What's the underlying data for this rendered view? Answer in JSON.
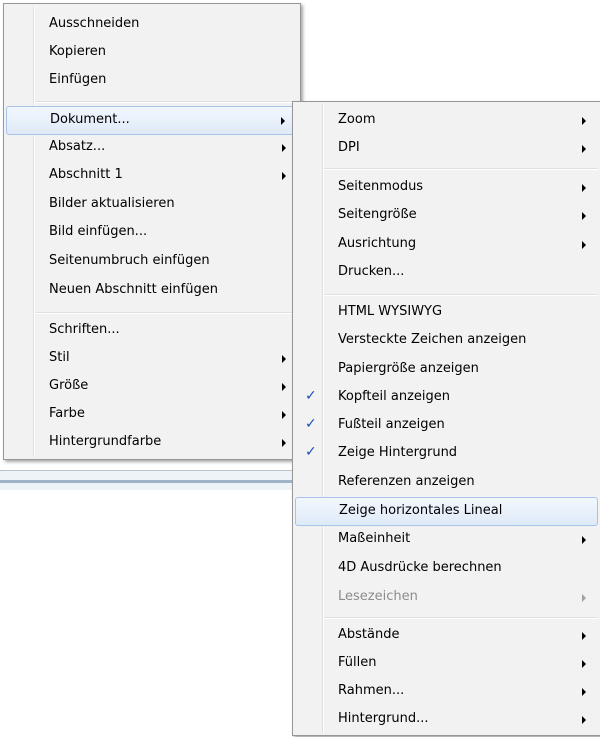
{
  "menu1": {
    "items": {
      "ausschneiden": {
        "label": "Ausschneiden"
      },
      "kopieren": {
        "label": "Kopieren"
      },
      "einfuegen": {
        "label": "Einfügen"
      },
      "dokument": {
        "label": "Dokument..."
      },
      "absatz": {
        "label": "Absatz..."
      },
      "abschnitt": {
        "label": "Abschnitt 1"
      },
      "bilder_aktualisieren": {
        "label": "Bilder aktualisieren"
      },
      "bild_einfuegen": {
        "label": "Bild einfügen..."
      },
      "seitenumbruch": {
        "label": "Seitenumbruch einfügen"
      },
      "neuer_abschnitt": {
        "label": "Neuen Abschnitt einfügen"
      },
      "schriften": {
        "label": "Schriften..."
      },
      "stil": {
        "label": "Stil"
      },
      "groesse": {
        "label": "Größe"
      },
      "farbe": {
        "label": "Farbe"
      },
      "hintergrundfarbe": {
        "label": "Hintergrundfarbe"
      }
    }
  },
  "menu2": {
    "items": {
      "zoom": {
        "label": "Zoom"
      },
      "dpi": {
        "label": "DPI"
      },
      "seitenmodus": {
        "label": "Seitenmodus"
      },
      "seitengroesse": {
        "label": "Seitengröße"
      },
      "ausrichtung": {
        "label": "Ausrichtung"
      },
      "drucken": {
        "label": "Drucken..."
      },
      "html_wysiwyg": {
        "label": "HTML WYSIWYG"
      },
      "versteckte_zeichen": {
        "label": "Versteckte Zeichen anzeigen"
      },
      "papiergroesse": {
        "label": "Papiergröße anzeigen"
      },
      "kopfteil": {
        "label": "Kopfteil anzeigen",
        "checked": true
      },
      "fussteil": {
        "label": "Fußteil anzeigen",
        "checked": true
      },
      "hintergrund_zeigen": {
        "label": "Zeige Hintergrund",
        "checked": true
      },
      "referenzen": {
        "label": "Referenzen anzeigen"
      },
      "lineal": {
        "label": "Zeige horizontales Lineal"
      },
      "masseinheit": {
        "label": "Maßeinheit"
      },
      "ausdruecke": {
        "label": "4D Ausdrücke berechnen"
      },
      "lesezeichen": {
        "label": "Lesezeichen",
        "disabled": true
      },
      "abstaende": {
        "label": "Abstände"
      },
      "fuellen": {
        "label": "Füllen"
      },
      "rahmen": {
        "label": "Rahmen..."
      },
      "hintergrund": {
        "label": "Hintergrund..."
      }
    },
    "check_glyph": "✓"
  },
  "colors": {
    "menu_bg": "#f2f2f2",
    "highlight_border": "#a7c4e8",
    "check": "#1a4fb5",
    "disabled_text": "#8c8c8c"
  }
}
